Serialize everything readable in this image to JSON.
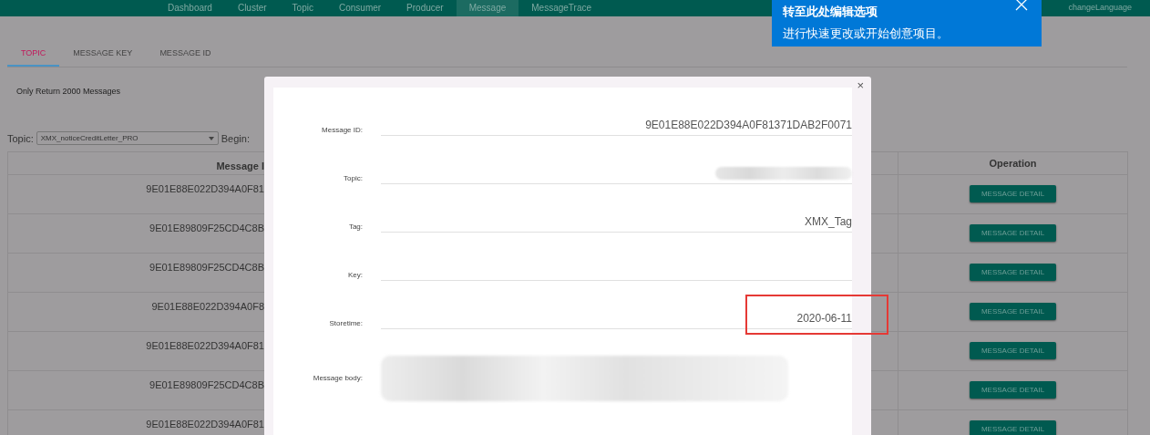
{
  "navbar": {
    "items": [
      {
        "label": "Dashboard",
        "selected": false
      },
      {
        "label": "Cluster",
        "selected": false
      },
      {
        "label": "Topic",
        "selected": false
      },
      {
        "label": "Consumer",
        "selected": false
      },
      {
        "label": "Producer",
        "selected": false
      },
      {
        "label": "Message",
        "selected": true
      },
      {
        "label": "MessageTrace",
        "selected": false
      }
    ],
    "language": "changeLanguage"
  },
  "tabs": [
    {
      "label": "TOPIC",
      "selected": true
    },
    {
      "label": "MESSAGE KEY",
      "selected": false
    },
    {
      "label": "MESSAGE ID",
      "selected": false
    }
  ],
  "notice": "Only Return 2000 Messages",
  "filter": {
    "topic_label": "Topic:",
    "topic_value": "XMX_noticeCreditLetter_PRO",
    "begin_label": "Begin:"
  },
  "table": {
    "columns": [
      "Message I",
      "Operation"
    ],
    "rows": [
      {
        "message_id": "9E01E88E022D394A0F81",
        "operation": "MESSAGE DETAIL"
      },
      {
        "message_id": "9E01E89809F25CD4C8B",
        "operation": "MESSAGE DETAIL"
      },
      {
        "message_id": "9E01E89809F25CD4C8B",
        "operation": "MESSAGE DETAIL"
      },
      {
        "message_id": "9E01E88E022D394A0F8",
        "operation": "MESSAGE DETAIL"
      },
      {
        "message_id": "9E01E88E022D394A0F81",
        "operation": "MESSAGE DETAIL"
      },
      {
        "message_id": "9E01E89809F25CD4C8B",
        "operation": "MESSAGE DETAIL"
      },
      {
        "message_id": "9E01E88E022D394A0F81",
        "operation": "MESSAGE DETAIL"
      }
    ]
  },
  "modal": {
    "close": "×",
    "fields": [
      {
        "label": "Message ID:",
        "kind": "text",
        "value": "9E01E88E022D394A0F81371DAB2F0071",
        "highlighted": false
      },
      {
        "label": "Topic:",
        "kind": "redacted",
        "highlighted": false
      },
      {
        "label": "Tag:",
        "kind": "text",
        "value": "XMX_Tag",
        "highlighted": false
      },
      {
        "label": "Key:",
        "kind": "text",
        "highlighted": false
      },
      {
        "label": "Storetime:",
        "kind": "text",
        "value": "2020-06-11",
        "highlighted": true
      },
      {
        "label": "Message body:",
        "kind": "redacted-body",
        "highlighted": false
      }
    ]
  },
  "toast": {
    "title": "转至此处编辑选项",
    "body": "进行快速更改或开始创意项目。"
  }
}
